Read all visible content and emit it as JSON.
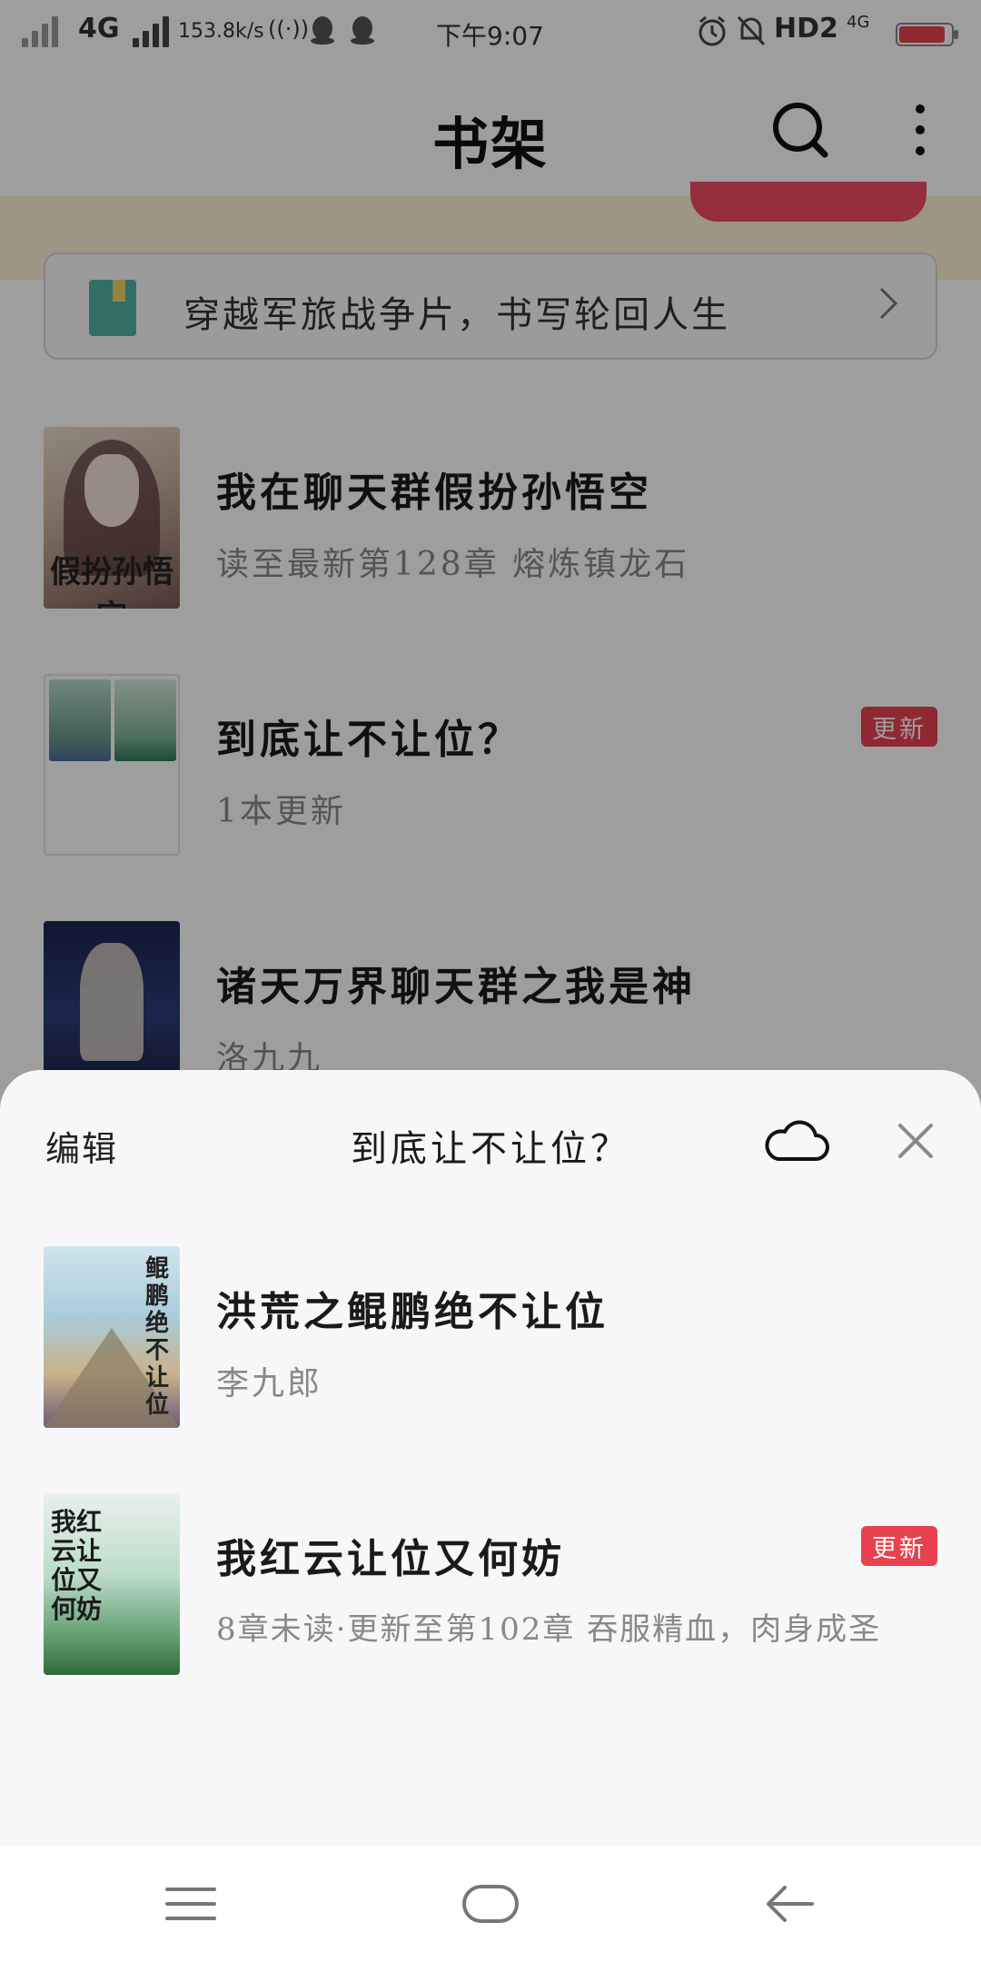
{
  "status_bar": {
    "network": "4G",
    "speed": "153.8k/s",
    "time": "下午9:07",
    "hd": "HD2",
    "network2": "4G"
  },
  "header": {
    "title": "书架",
    "search_icon": "search-icon",
    "more_icon": "more-vertical-icon"
  },
  "notice": {
    "text": "穿越军旅战争片，书写轮回人生",
    "icon": "book-icon"
  },
  "books": [
    {
      "title": "我在聊天群假扮孙悟空",
      "subtitle": "读至最新第128章 熔炼镇龙石",
      "cover_caption": "假扮孙悟空",
      "badge": ""
    },
    {
      "title": "到底让不让位？",
      "subtitle": "1本更新",
      "badge": "更新"
    },
    {
      "title": "诸天万界聊天群之我是神",
      "subtitle": "洛九九",
      "badge": ""
    }
  ],
  "sheet": {
    "edit_label": "编辑",
    "title": "到底让不让位？",
    "cloud_icon": "cloud-icon",
    "close_icon": "close-icon",
    "items": [
      {
        "title": "洪荒之鲲鹏绝不让位",
        "subtitle": "李九郎",
        "badge": "",
        "cover_text": "鲲鹏绝不让位"
      },
      {
        "title": "我红云让位又何妨",
        "subtitle": "8章未读·更新至第102章 吞服精血，肉身成圣",
        "badge": "更新",
        "cover_text": "我红云让位又何妨"
      }
    ]
  },
  "nav": {
    "menu_icon": "menu-icon",
    "home_icon": "home-icon",
    "back_icon": "back-icon"
  },
  "colors": {
    "badge_red": "#e8424f",
    "sheet_bg": "#f7f7f9",
    "promo_bg": "#fff2d6"
  }
}
